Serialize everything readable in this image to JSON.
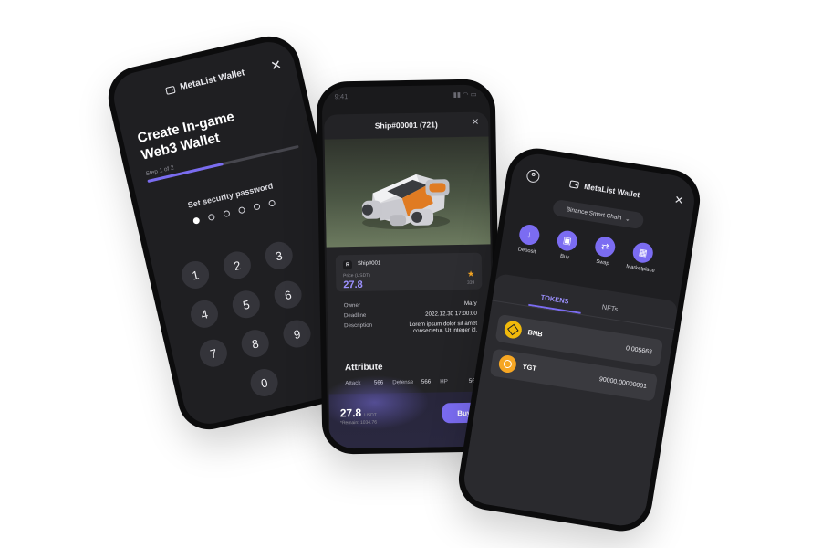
{
  "create_wallet": {
    "brand": "MetaList Wallet",
    "title_line1": "Create In-game",
    "title_line2": "Web3 Wallet",
    "step": "Step 1 of 2",
    "progress": 0.5,
    "password_label": "Set security password",
    "entered_digits": 1,
    "total_digits": 6,
    "keys": [
      "1",
      "2",
      "3",
      "4",
      "5",
      "6",
      "7",
      "8",
      "9",
      "0"
    ]
  },
  "ship_detail": {
    "time": "9:41",
    "title": "Ship#00001 (721)",
    "item_badge": "R",
    "item_name": "Ship#001",
    "price_label": "Price (USDT)",
    "price": "27.8",
    "likes": "339",
    "rows": [
      {
        "label": "Owner",
        "value": "Mary"
      },
      {
        "label": "Deadline",
        "value": "2022.12.30 17:00:00"
      },
      {
        "label": "Description",
        "value": "Lorem ipsum dolor sit amet consectetur. Ut integer id."
      }
    ],
    "attribute_title": "Attribute",
    "attributes": [
      {
        "label": "Attack",
        "value": "566"
      },
      {
        "label": "Defense",
        "value": "566"
      },
      {
        "label": "HP",
        "value": "566"
      }
    ],
    "bottom_price": "27.8",
    "bottom_unit": "USDT",
    "remain": "*Remain: 1034.76",
    "buy_label": "Buy"
  },
  "wallet_home": {
    "brand": "MetaList Wallet",
    "chain": "Binance Smart Chain",
    "actions": [
      {
        "label": "Deposit",
        "icon": "arrow-down-icon"
      },
      {
        "label": "Buy",
        "icon": "wallet-icon"
      },
      {
        "label": "Swap",
        "icon": "swap-icon"
      },
      {
        "label": "Marketplace",
        "icon": "store-icon"
      }
    ],
    "tabs": [
      "TOKENS",
      "NFTs"
    ],
    "active_tab": "TOKENS",
    "tokens": [
      {
        "symbol": "BNB",
        "amount": "0.005663"
      },
      {
        "symbol": "YGT",
        "amount": "90000.00000001"
      }
    ]
  },
  "colors": {
    "accent": "#7b6cf2",
    "background": "#1f1f22"
  }
}
